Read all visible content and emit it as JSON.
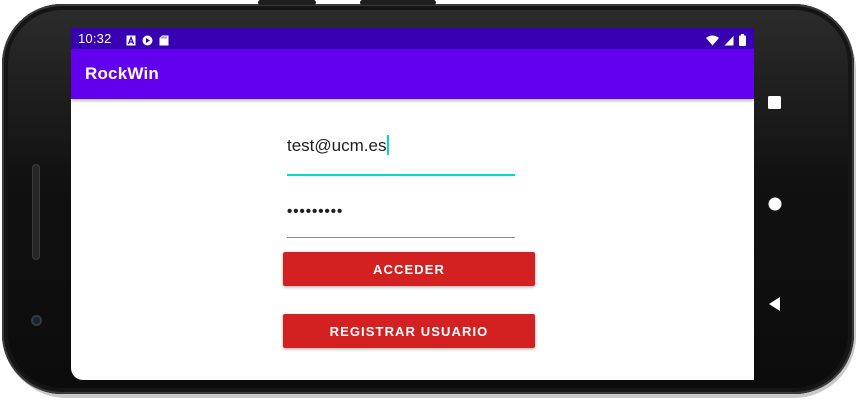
{
  "status_bar": {
    "time": "10:32",
    "left_icons": [
      "a-notification-icon",
      "play-protect-icon",
      "sd-card-icon"
    ],
    "right_icons": [
      "wifi-icon",
      "signal-icon",
      "battery-icon"
    ],
    "background": "#3700b3"
  },
  "app_bar": {
    "title": "RockWin",
    "background": "#6200ee"
  },
  "form": {
    "email_value": "test@ucm.es",
    "password_value": "•••••••••",
    "login_label": "ACCEDER",
    "register_label": "REGISTRAR USUARIO",
    "button_color": "#d32020",
    "focus_color": "#03dac5"
  },
  "nav_bar": {
    "buttons": [
      "recents-square-icon",
      "home-circle-icon",
      "back-triangle-icon"
    ]
  }
}
